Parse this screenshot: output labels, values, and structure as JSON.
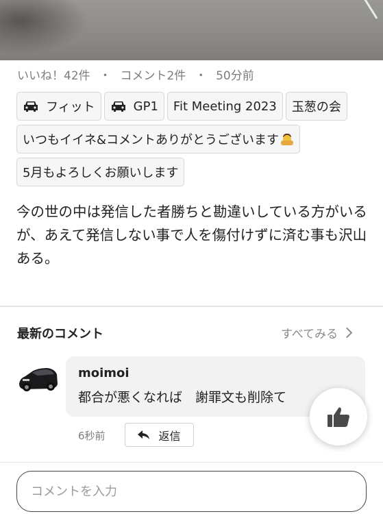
{
  "post": {
    "likes": "いいね！42件",
    "comments": "コメント2件",
    "time": "50分前",
    "separator": "・",
    "tags": [
      {
        "icon": "car-icon",
        "label": "フィット"
      },
      {
        "icon": "car-icon",
        "label": "GP1"
      },
      {
        "label": "Fit Meeting 2023"
      },
      {
        "label": "玉葱の会"
      },
      {
        "label": "いつもイイネ&コメントありがとうございます",
        "emoji": "praying-person-emoji"
      },
      {
        "label": "5月もよろしくお願いします"
      }
    ],
    "body": "今の世の中は発信した者勝ちと勘違いしている方がいるが、あえて発信しない事で人を傷付けずに済む事も沢山ある。"
  },
  "comments_section": {
    "title": "最新のコメント",
    "see_all": "すべてみる",
    "items": [
      {
        "author": "moimoi",
        "text": "都合が悪くなれば　謝罪文も削除て",
        "time": "6秒前",
        "reply_label": "返信"
      }
    ]
  },
  "comment_input": {
    "placeholder": "コメントを入力"
  },
  "colors": {
    "muted_text": "#7d7d7d",
    "bubble_bg": "#f2f2f2",
    "tag_bg": "#f6f6f6"
  }
}
